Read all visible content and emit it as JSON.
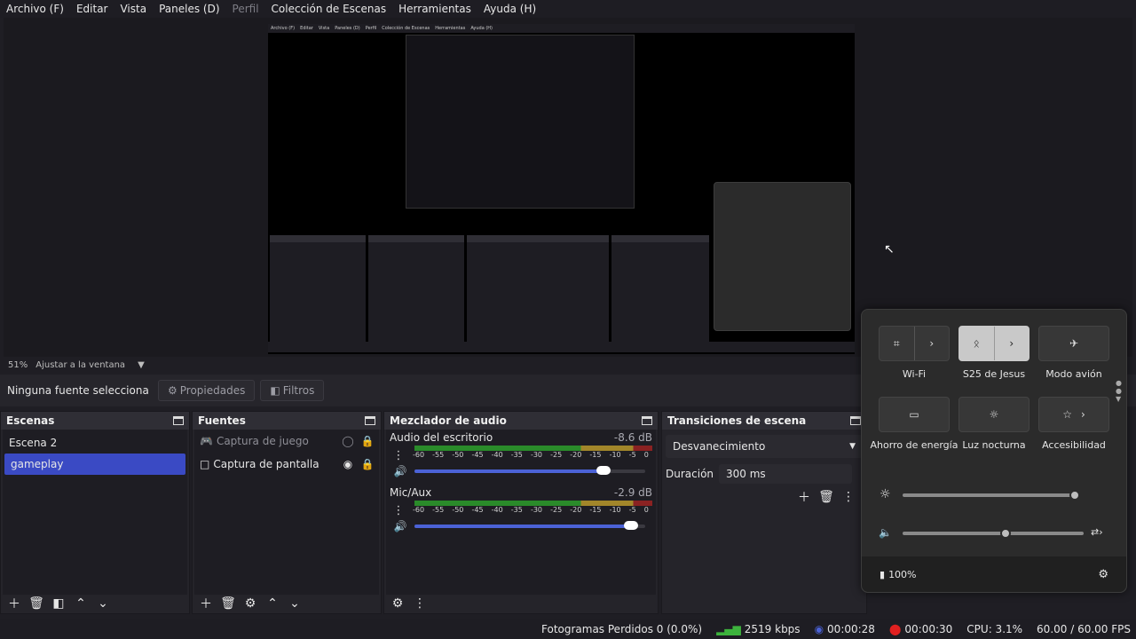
{
  "menu": [
    "Archivo (F)",
    "Editar",
    "Vista",
    "Paneles (D)",
    "Perfil",
    "Colección de Escenas",
    "Herramientas",
    "Ayuda (H)"
  ],
  "zoom": {
    "percent": "51%",
    "fit_label": "Ajustar a la ventana"
  },
  "source_bar": {
    "no_source": "Ninguna fuente selecciona",
    "properties": "Propiedades",
    "filters": "Filtros"
  },
  "scenes": {
    "title": "Escenas",
    "items": [
      "Escena 2",
      "gameplay"
    ],
    "selected": "gameplay"
  },
  "sources": {
    "title": "Fuentes",
    "items": [
      {
        "label": "Captura de juego",
        "icon": "gamepad-icon",
        "visible": false
      },
      {
        "label": "Captura de pantalla",
        "icon": "monitor-icon",
        "visible": true
      }
    ]
  },
  "mixer": {
    "title": "Mezclador de audio",
    "ticks": [
      "-60",
      "-55",
      "-50",
      "-45",
      "-40",
      "-35",
      "-30",
      "-25",
      "-20",
      "-15",
      "-10",
      "-5",
      "0"
    ],
    "channels": [
      {
        "name": "Audio del escritorio",
        "db": "-8.6 dB",
        "volume": 0.82
      },
      {
        "name": "Mic/Aux",
        "db": "-2.9 dB",
        "volume": 0.94
      }
    ]
  },
  "transitions": {
    "title": "Transiciones de escena",
    "selected": "Desvanecimiento",
    "duration_label": "Duración",
    "duration_value": "300 ms"
  },
  "status": {
    "dropped": "Fotogramas Perdidos 0 (0.0%)",
    "bitrate": "2519 kbps",
    "stream_time": "00:00:28",
    "rec_time": "00:00:30",
    "cpu": "CPU: 3.1%",
    "fps": "60.00 / 60.00 FPS"
  },
  "quick_settings": {
    "tiles": [
      {
        "label": "Wi-Fi",
        "icon": "wifi-icon",
        "on": false,
        "expand": true
      },
      {
        "label": "S25 de Jesus",
        "icon": "bluetooth-icon",
        "on": true,
        "expand": true
      },
      {
        "label": "Modo avión",
        "icon": "airplane-icon",
        "on": false,
        "expand": false
      },
      {
        "label": "Ahorro de energía",
        "icon": "battery-saver-icon",
        "on": false,
        "expand": false
      },
      {
        "label": "Luz nocturna",
        "icon": "night-light-icon",
        "on": false,
        "expand": false
      },
      {
        "label": "Accesibilidad",
        "icon": "accessibility-icon",
        "on": false,
        "expand": true
      }
    ],
    "brightness": 0.98,
    "volume": 0.57,
    "battery": "100%"
  },
  "colors": {
    "accent": "#3a4ac4",
    "slider_fill": "#4b62d6",
    "rec": "#e02020",
    "bitrate": "#3db33d"
  }
}
